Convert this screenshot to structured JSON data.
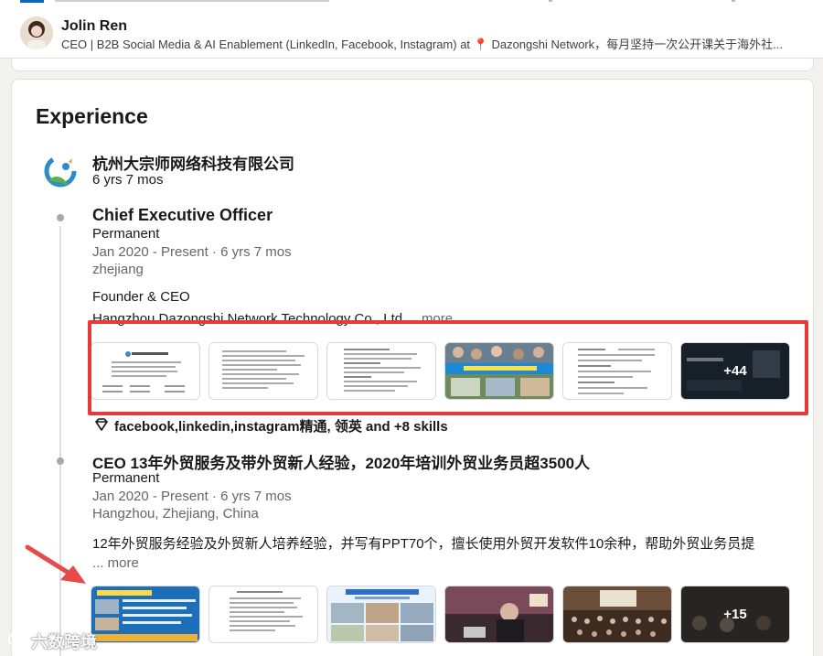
{
  "profile": {
    "name": "Jolin Ren",
    "headline": "CEO | B2B Social Media & AI Enablement (LinkedIn, Facebook, Instagram) at 📍 Dazongshi Network，每月坚持一次公开课关于海外社..."
  },
  "experience": {
    "title": "Experience",
    "company": {
      "name": "杭州大宗师网络科技有限公司",
      "duration": "6 yrs 7 mos",
      "logo_icon": "company-logo-icon"
    },
    "roles": [
      {
        "title": "Chief Executive Officer",
        "type": "Permanent",
        "dates": "Jan 2020 - Present · 6 yrs 7 mos",
        "location": "zhejiang",
        "desc_line1": "Founder & CEO",
        "desc_line2": "Hangzhou Dazongshi Network Technology Co., Ltd.",
        "more": "...more",
        "media_more": "+44",
        "skills": "facebook,linkedin,instagram精通, 领英 and +8 skills"
      },
      {
        "title": "CEO  13年外贸服务及带外贸新人经验，2020年培训外贸业务员超3500人",
        "type": "Permanent",
        "dates": "Jan 2020 - Present · 6 yrs 7 mos",
        "location": "Hangzhou, Zhejiang, China",
        "desc_line1": "12年外贸服务经验及外贸新人培养经验，并写有PPT70个，擅长使用外贸开发软件10余种，帮助外贸业务员提",
        "more": "... more",
        "media_more": "+15"
      }
    ]
  },
  "watermark": "六数跨境",
  "colors": {
    "accent": "#0a66c2",
    "highlight": "#e63a3a",
    "arrow": "#e84a4a"
  }
}
